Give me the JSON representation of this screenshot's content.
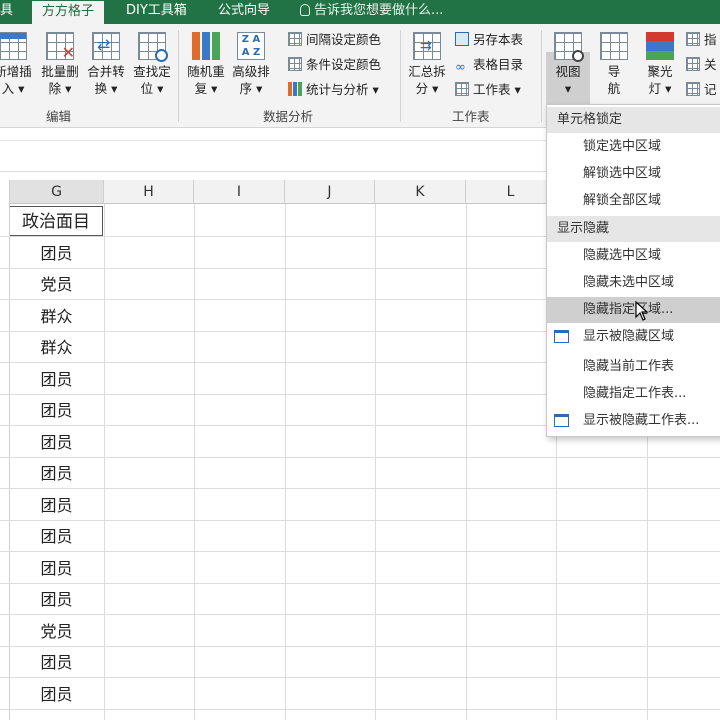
{
  "tabs": [
    {
      "label": "具",
      "active": false
    },
    {
      "label": "方方格子",
      "active": true
    },
    {
      "label": "DIY工具箱",
      "active": false
    },
    {
      "label": "公式向导",
      "active": false
    }
  ],
  "tell_me": "告诉我您想要做什么...",
  "ribbon": {
    "edit": {
      "btn1": {
        "line1": "新增插",
        "line2": "入 ▾"
      },
      "btn2": {
        "line1": "批量删",
        "line2": "除 ▾"
      },
      "btn3": {
        "line1": "合并转",
        "line2": "换 ▾"
      },
      "btn4": {
        "line1": "查找定",
        "line2": "位 ▾"
      },
      "group_label": "编辑"
    },
    "analysis": {
      "btn1": {
        "line1": "随机重",
        "line2": "复 ▾"
      },
      "btn2": {
        "line1": "高级排",
        "line2": "序 ▾"
      },
      "small1": "间隔设定颜色",
      "small2": "条件设定颜色",
      "small3": "统计与分析 ▾",
      "group_label": "数据分析"
    },
    "sheet": {
      "btn1": {
        "line1": "汇总拆",
        "line2": "分 ▾"
      },
      "small1": "另存本表",
      "small2": "表格目录",
      "small3": "工作表 ▾",
      "group_label": "工作表"
    },
    "view": {
      "view_btn": {
        "line1": "视图",
        "line2": "▾"
      },
      "nav_btn": {
        "line1": "导",
        "line2": "航"
      },
      "spot_btn": {
        "line1": "聚光",
        "line2": "灯 ▾"
      },
      "small1": "指",
      "small2": "关",
      "small3": "记"
    }
  },
  "grid": {
    "columns": [
      "G",
      "H",
      "I",
      "J",
      "K",
      "L"
    ],
    "header_cell": "政治面目",
    "values": [
      "团员",
      "党员",
      "群众",
      "群众",
      "团员",
      "团员",
      "团员",
      "团员",
      "团员",
      "团员",
      "团员",
      "团员",
      "党员",
      "团员",
      "团员"
    ]
  },
  "menu": {
    "section1": "单元格锁定",
    "lock_selected": "锁定选中区域",
    "unlock_selected": "解锁选中区域",
    "unlock_all": "解锁全部区域",
    "section2": "显示隐藏",
    "hide_selected": "隐藏选中区域",
    "hide_unselected": "隐藏未选中区域",
    "hide_specified": "隐藏指定区域...",
    "show_hidden": "显示被隐藏区域",
    "hide_current_sheet": "隐藏当前工作表",
    "hide_specified_sheet": "隐藏指定工作表...",
    "show_hidden_sheets": "显示被隐藏工作表..."
  },
  "colors": {
    "excel_green": "#217346",
    "ribbon_bg": "#f3f3f3",
    "menu_highlight": "#cfcfcf"
  }
}
